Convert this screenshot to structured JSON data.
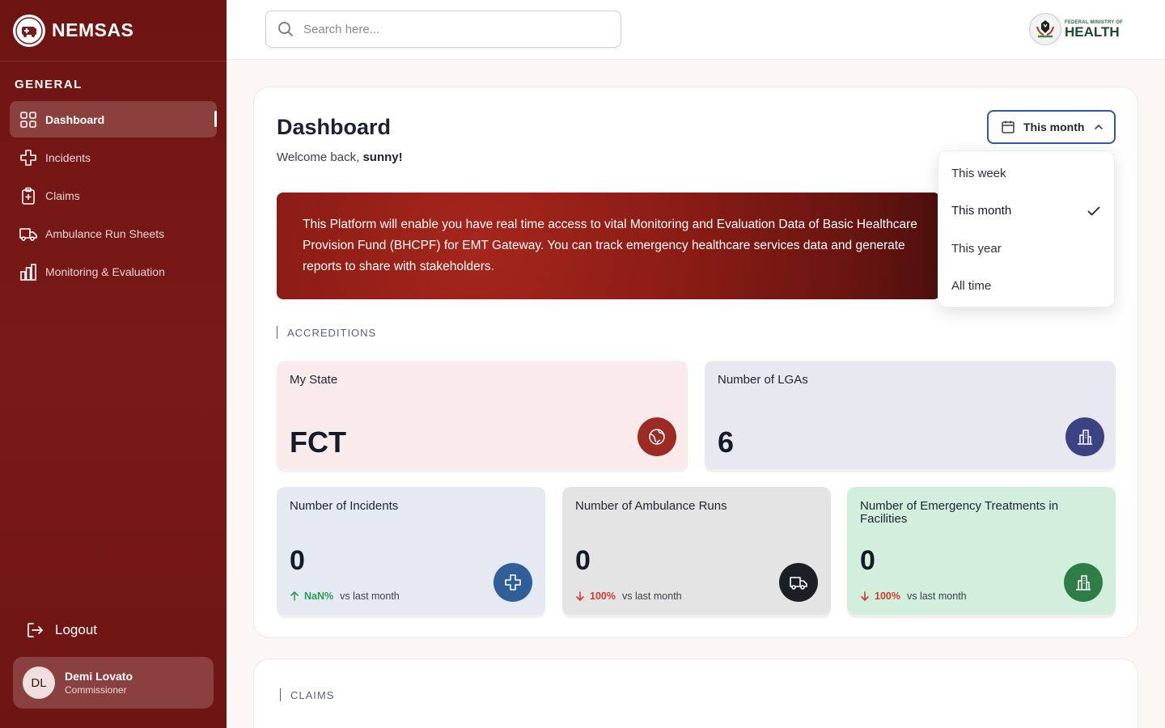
{
  "sidebar": {
    "brand": "NEMSAS",
    "brand_logo_text": "NEMSAS",
    "section": "GENERAL",
    "items": [
      {
        "label": "Dashboard",
        "icon": "grid-icon",
        "active": true
      },
      {
        "label": "Incidents",
        "icon": "cross-icon"
      },
      {
        "label": "Claims",
        "icon": "clipboard-plus-icon"
      },
      {
        "label": "Ambulance Run Sheets",
        "icon": "ambulance-icon"
      },
      {
        "label": "Monitoring & Evaluation",
        "icon": "bar-chart-icon"
      }
    ],
    "logout": "Logout",
    "user": {
      "initials": "DL",
      "name": "Demi Lovato",
      "role": "Commissioner"
    }
  },
  "header": {
    "search_placeholder": "Search here...",
    "logo_small": "FEDERAL MINISTRY OF",
    "logo_big": "HEALTH"
  },
  "main": {
    "title": "Dashboard",
    "welcome_prefix": "Welcome back, ",
    "welcome_user": "sunny!",
    "period_selected": "This month",
    "banner_text": "This Platform will enable you have real time access to vital Monitoring and Evaluation Data of Basic Healthcare Provision Fund (BHCPF) for EMT Gateway. You can track emergency healthcare services data and generate reports to share with stakeholders.",
    "section_accreditions": "ACCREDITIONS",
    "section_claims": "CLAIMS",
    "cards": {
      "state": {
        "label": "My State",
        "value": "FCT",
        "icon": "globe-icon",
        "color": "#9b2a25"
      },
      "lgas": {
        "label": "Number of LGAs",
        "value": "6",
        "icon": "building-icon",
        "color": "#3d4283"
      },
      "incidents": {
        "label": "Number of Incidents",
        "value": "0",
        "trend": "NaN%",
        "trend_dir": "up",
        "trend_suffix": "vs last month",
        "icon": "cross-icon",
        "color": "#2f5f96"
      },
      "runs": {
        "label": "Number of Ambulance Runs",
        "value": "0",
        "trend": "100%",
        "trend_dir": "down",
        "trend_suffix": "vs last month",
        "icon": "truck-icon",
        "color": "#1b1f26"
      },
      "treatments": {
        "label": "Number of Emergency Treatments in Facilities",
        "value": "0",
        "trend": "100%",
        "trend_dir": "down",
        "trend_suffix": "vs last month",
        "icon": "building-icon",
        "color": "#2f7d46"
      }
    }
  },
  "dropdown": {
    "options": [
      "This week",
      "This month",
      "This year",
      "All time"
    ],
    "selected": "This month"
  }
}
